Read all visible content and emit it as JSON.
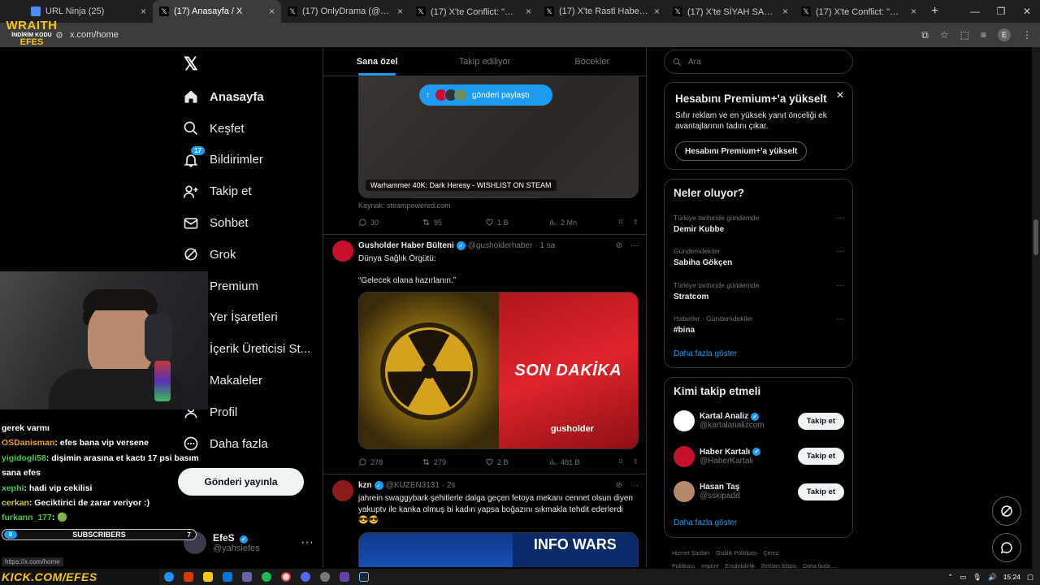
{
  "browser": {
    "tabs": [
      {
        "title": "URL Ninja (25)",
        "fav_color": "#4a8cff"
      },
      {
        "title": "(17) Anasayfa / X",
        "fav_color": "#000000",
        "active": true
      },
      {
        "title": "(17) OnlyDrama (@onlydramaX...",
        "fav_color": "#000000"
      },
      {
        "title": "(17) X'te Conflict: \"🔴 Netanyahu...",
        "fav_color": "#000000"
      },
      {
        "title": "(17) X'te Rastl Haber: \"Menengi...",
        "fav_color": "#000000"
      },
      {
        "title": "(17) X'te SİYAH SANCAK: \"🔵 S...",
        "fav_color": "#000000"
      },
      {
        "title": "(17) X'te Conflict: \"🔺 İran'ın ba...",
        "fav_color": "#000000"
      }
    ],
    "url": "x.com/home",
    "profile_initial": "E",
    "status_url": "https://x.com/home"
  },
  "overlay": {
    "brand_line1": "WRAITH",
    "brand_line2": "İNDİRİM KODU",
    "brand_line3": "EFES",
    "chat": [
      {
        "user": "",
        "text": "gerek varmı",
        "user_color": "#ffffff"
      },
      {
        "user": "OSDanisman",
        "text": ": efes bana vip versene",
        "user_color": "#f0a020"
      },
      {
        "user": "yigidogli58",
        "text": ": dişimin arasına et kactı 17 psi basım sana efes",
        "user_color": "#46c84b"
      },
      {
        "user": "xephi",
        "text": ": hadi vip cekilisi",
        "user_color": "#46c84b"
      },
      {
        "user": "cerkan",
        "text": ": Geciktirici de zarar veriyor :)",
        "user_color": "#c8c83c"
      },
      {
        "user": "furkann_177",
        "text": ": 🟢",
        "user_color": "#46c84b"
      }
    ],
    "subs_label": "SUBSCRIBERS",
    "subs_count": "0",
    "subs_goal": "7",
    "promo": "KICK.COM/EFES"
  },
  "x": {
    "nav": [
      {
        "label": "Anasayfa",
        "icon": "home-icon",
        "active": true
      },
      {
        "label": "Keşfet",
        "icon": "search-icon"
      },
      {
        "label": "Bildirimler",
        "icon": "bell-icon",
        "badge": "17"
      },
      {
        "label": "Takip et",
        "icon": "add-person-icon"
      },
      {
        "label": "Sohbet",
        "icon": "mail-icon"
      },
      {
        "label": "Grok",
        "icon": "grok-icon"
      },
      {
        "label": "Premium",
        "icon": "x-premium-icon"
      },
      {
        "label": "Yer İşaretleri",
        "icon": "bookmark-icon"
      },
      {
        "label": "İçerik Üreticisi St...",
        "icon": "creator-icon"
      },
      {
        "label": "Makaleler",
        "icon": "article-icon"
      },
      {
        "label": "Profil",
        "icon": "profile-icon"
      },
      {
        "label": "Daha fazla",
        "icon": "more-circle-icon"
      }
    ],
    "post_button": "Gönderi yayınla",
    "account": {
      "name": "EfeS",
      "handle": "@yahsiefes"
    },
    "feed_tabs": [
      "Sana özel",
      "Takip ediliyor",
      "Böcekler"
    ],
    "share_pill": "gönderi paylaştı",
    "card": {
      "caption": "Warhammer 40K: Dark Heresy - WISHLIST ON STEAM",
      "source": "Kaynak: steampowered.com",
      "stats": {
        "replies": "30",
        "reposts": "95",
        "likes": "1 B",
        "views": "2 Mn"
      }
    },
    "tweet1": {
      "name": "Gusholder Haber Bülteni",
      "handle": "@gusholderhaber",
      "time": "· 1 sa",
      "line1": "Dünya Sağlık Örgütü:",
      "line2": "“Gelecek olana hazırlanın.”",
      "media_text": "SON DAKİKA",
      "media_logo": "gusholder",
      "stats": {
        "replies": "278",
        "reposts": "279",
        "likes": "2 B",
        "views": "461 B"
      }
    },
    "tweet2": {
      "name": "kzn",
      "handle": "@KUZEN3131",
      "time": "· 2s",
      "text": "jahrein swaggybark şehitlerle dalga geçen fetoya mekanı cennet olsun diyen yakuptv ile kanka olmuş bi kadın yapsa boğazını sıkmakla tehdit ederlerdi 😎😎",
      "media_text": "INFO WARS"
    },
    "search_placeholder": "Ara",
    "premium": {
      "title": "Hesabını Premium+'a yükselt",
      "body": "Sıfır reklam ve en yüksek yanıt önceliği ek avantajlarının tadını çıkar.",
      "button": "Hesabını Premium+'a yükselt"
    },
    "trends": {
      "title": "Neler oluyor?",
      "items": [
        {
          "context": "Türkiye tarihinde gündemde",
          "topic": "Demir Kubbe"
        },
        {
          "context": "Gündemdekiler",
          "topic": "Sabiha Gökçen"
        },
        {
          "context": "Türkiye tarihinde gündemde",
          "topic": "Stratcom"
        },
        {
          "context": "Haberler · Gündemdekiler",
          "topic": "#bina"
        }
      ],
      "more": "Daha fazla göster"
    },
    "who": {
      "title": "Kimi takip etmeli",
      "items": [
        {
          "name": "Kartal Analiz",
          "handle": "@kartalanalizcom",
          "button": "Takip et",
          "color": "#ffffff"
        },
        {
          "name": "Haber Kartalı",
          "handle": "@HaberKartali",
          "button": "Takip et",
          "color": "#c8102e"
        },
        {
          "name": "Hasan Taş",
          "handle": "@sskipadd",
          "button": "Takip et",
          "color": "#b58a6a"
        }
      ],
      "more": "Daha fazla göster"
    },
    "footer": [
      "Hizmet Şartları",
      "Gizlilik Politikası",
      "Çerez Politikası",
      "Imprint",
      "Erişilebilirlik",
      "Reklam bilgisi",
      "Daha fazla ..."
    ]
  },
  "taskbar": {
    "time": "15:24"
  }
}
